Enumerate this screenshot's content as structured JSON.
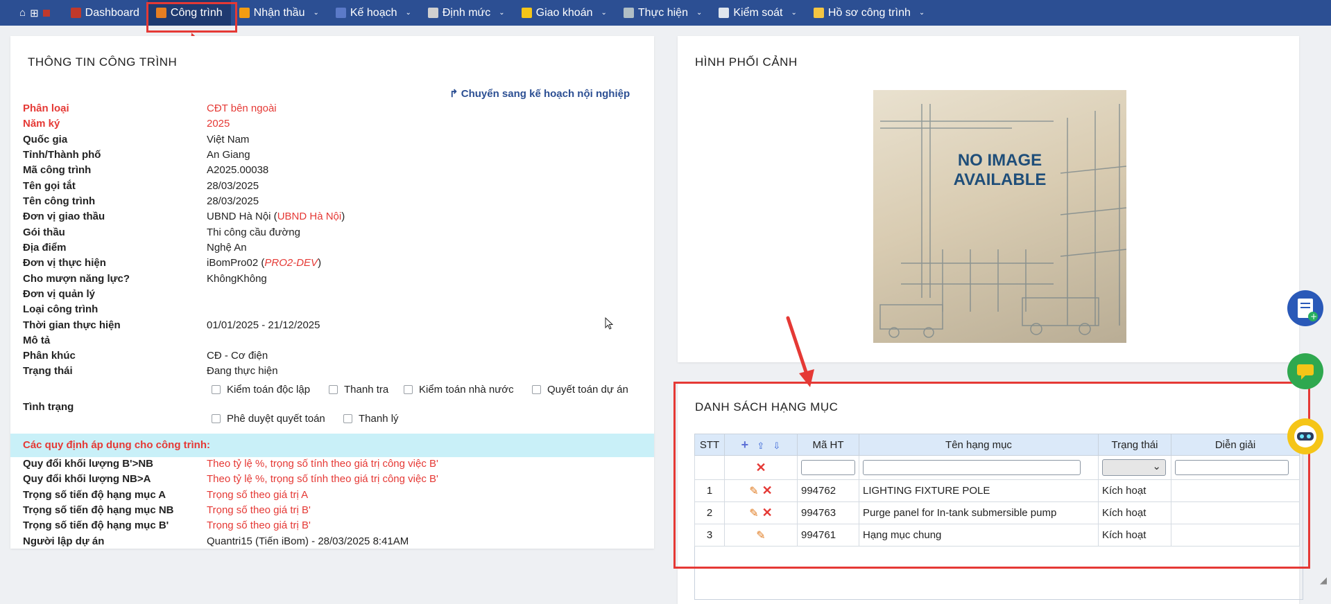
{
  "nav": {
    "items": [
      {
        "label": "Dashboard",
        "icon": "dashboard-icon",
        "color": "#c0392b"
      },
      {
        "label": "Công trình",
        "icon": "building-icon",
        "color": "#e67e22"
      },
      {
        "label": "Nhận thầu",
        "icon": "document-icon",
        "color": "#f39c12"
      },
      {
        "label": "Kế hoạch",
        "icon": "calendar-icon",
        "color": "#5b7ac8"
      },
      {
        "label": "Định mức",
        "icon": "gear-icon",
        "color": "#d0d0d0"
      },
      {
        "label": "Giao khoán",
        "icon": "handshake-icon",
        "color": "#f5c518"
      },
      {
        "label": "Thực hiện",
        "icon": "tools-icon",
        "color": "#b0bec5"
      },
      {
        "label": "Kiểm soát",
        "icon": "clipboard-icon",
        "color": "#dfe6ee"
      },
      {
        "label": "Hồ sơ công trình",
        "icon": "folder-icon",
        "color": "#f4c542"
      }
    ]
  },
  "info": {
    "title": "THÔNG TIN CÔNG TRÌNH",
    "switch_link": "Chuyển sang kế hoạch nội nghiệp",
    "rows": [
      {
        "label": "Phân loại",
        "value": "CĐT bên ngoài",
        "red": true
      },
      {
        "label": "Năm ký",
        "value": "2025",
        "red": true
      },
      {
        "label": "Quốc gia",
        "value": "Việt Nam"
      },
      {
        "label": "Tỉnh/Thành phố",
        "value": "An Giang"
      },
      {
        "label": "Mã công trình",
        "value": "A2025.00038"
      },
      {
        "label": "Tên gọi tắt",
        "value": "28/03/2025"
      },
      {
        "label": "Tên công trình",
        "value": "28/03/2025"
      },
      {
        "label": "Đơn vị giao thầu",
        "value": "UBND Hà Nội (",
        "value_red": "UBND Hà Nội",
        "value_end": ")"
      },
      {
        "label": "Gói thầu",
        "value": "Thi công cầu đường"
      },
      {
        "label": "Địa điểm",
        "value": "Nghệ An"
      },
      {
        "label": "Đơn vị thực hiện",
        "value": "iBomPro02 (",
        "value_red": "PRO2-DEV",
        "value_end": ")"
      },
      {
        "label": "Cho mượn năng lực?",
        "value": "KhôngKhông"
      },
      {
        "label": "Đơn vị quản lý",
        "value": ""
      },
      {
        "label": "Loại công trình",
        "value": ""
      },
      {
        "label": "Thời gian thực hiện",
        "value": "01/01/2025 - 21/12/2025"
      },
      {
        "label": "Mô tả",
        "value": ""
      },
      {
        "label": "Phân khúc",
        "value": "CĐ - Cơ điện"
      },
      {
        "label": "Trạng thái",
        "value": "Đang thực hiện"
      }
    ],
    "tinh_trang_label": "Tình trạng",
    "checkboxes": [
      "Kiểm toán độc lập",
      "Thanh tra",
      "Kiểm toán nhà nước",
      "Quyết toán dự án",
      "Phê duyệt quyết toán",
      "Thanh lý"
    ],
    "rules_title": "Các quy định áp dụng cho công trình:",
    "rules": [
      {
        "label": "Quy đổi khối lượng B'>NB",
        "value": "Theo tỷ lệ %, trọng số tính theo giá trị công việc B'"
      },
      {
        "label": "Quy đổi khối lượng NB>A",
        "value": "Theo tỷ lệ %, trọng số tính theo giá trị công việc B'"
      },
      {
        "label": "Trọng số tiến độ hạng mục A",
        "value": "Trọng số theo giá trị A"
      },
      {
        "label": "Trọng số tiến độ hạng mục NB",
        "value": "Trọng số theo giá trị B'"
      },
      {
        "label": "Trọng số tiến độ hạng mục B'",
        "value": "Trọng số theo giá trị B'"
      },
      {
        "label": "Người lập dự án",
        "value": "Quantri15 (Tiến iBom) - 28/03/2025 8:41AM",
        "black": true
      }
    ]
  },
  "image_panel": {
    "title": "HÌNH PHỐI CẢNH",
    "placeholder_line1": "NO IMAGE",
    "placeholder_line2": "AVAILABLE"
  },
  "items_panel": {
    "title": "DANH SÁCH HẠNG MỤC",
    "headers": {
      "stt": "STT",
      "ma": "Mã HT",
      "ten": "Tên hạng mục",
      "trang_thai": "Trạng thái",
      "dien_giai": "Diễn giải"
    },
    "rows": [
      {
        "stt": "1",
        "ma": "994762",
        "ten": "LIGHTING FIXTURE POLE",
        "trang_thai": "Kích hoạt",
        "dien_giai": "",
        "deletable": true
      },
      {
        "stt": "2",
        "ma": "994763",
        "ten": "Purge panel for In-tank submersible pump",
        "trang_thai": "Kích hoạt",
        "dien_giai": "",
        "deletable": true
      },
      {
        "stt": "3",
        "ma": "994761",
        "ten": "Hạng mục chung",
        "trang_thai": "Kích hoạt",
        "dien_giai": "",
        "deletable": false
      }
    ]
  },
  "colors": {
    "nav_bg": "#2c4f93",
    "accent_red": "#e53935",
    "link_blue": "#2c4f93",
    "band": "#c9f0f8"
  }
}
